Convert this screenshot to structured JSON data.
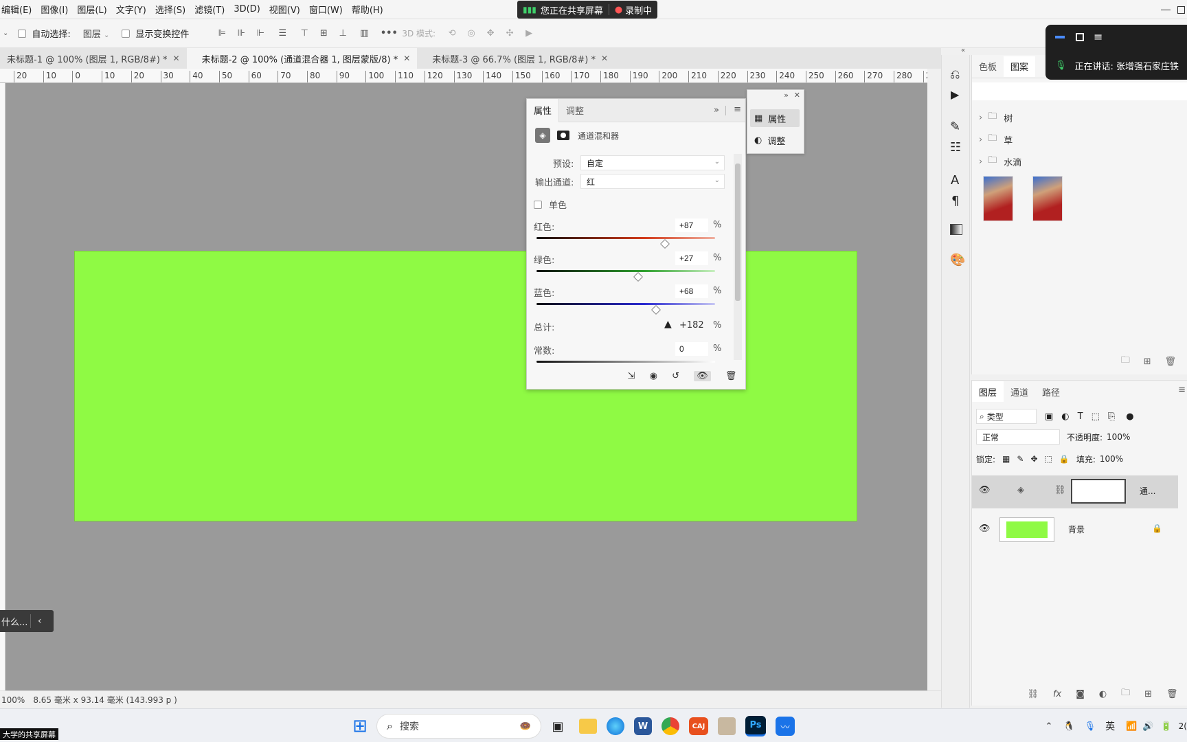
{
  "menubar": {
    "items": [
      "编辑(E)",
      "图像(I)",
      "图层(L)",
      "文字(Y)",
      "选择(S)",
      "滤镜(T)",
      "3D(D)",
      "视图(V)",
      "窗口(W)",
      "帮助(H)"
    ],
    "share_status": "您正在共享屏幕",
    "recording": "录制中"
  },
  "options": {
    "auto_select_label": "自动选择:",
    "auto_select_value": "图层",
    "show_transform_label": "显示变换控件",
    "mode_3d_label": "3D 模式:"
  },
  "tabs": [
    {
      "label": "未标题-1 @ 100% (图层 1, RGB/8#) *",
      "active": false
    },
    {
      "label": "未标题-2 @ 100% (通道混合器 1, 图层蒙版/8) *",
      "active": true
    },
    {
      "label": "未标题-3 @ 66.7% (图层 1, RGB/8#) *",
      "active": false
    }
  ],
  "ruler": {
    "ticks": [
      "20",
      "10",
      "0",
      "10",
      "20",
      "30",
      "40",
      "50",
      "60",
      "70",
      "80",
      "90",
      "100",
      "110",
      "120",
      "130",
      "140",
      "150",
      "160",
      "170",
      "180",
      "190",
      "200",
      "210",
      "220",
      "230",
      "240",
      "250",
      "260",
      "270",
      "280",
      "2"
    ]
  },
  "canvas": {
    "fill_color": "#8ffa44",
    "mini_label": "什么..."
  },
  "status": {
    "zoom": "100%",
    "info": "8.65 毫米 x 93.14 毫米 (143.993 p )"
  },
  "properties": {
    "tab_props": "属性",
    "tab_adjust": "调整",
    "adjustment_name": "通道混和器",
    "preset_label": "预设:",
    "preset_value": "自定",
    "output_label": "输出通道:",
    "output_value": "红",
    "mono_label": "单色",
    "red_label": "红色:",
    "red_value": "+87",
    "red_pct": 0.87,
    "green_label": "绿色:",
    "green_value": "+27",
    "green_pct": 0.27,
    "blue_label": "蓝色:",
    "blue_value": "+68",
    "blue_pct": 0.68,
    "total_label": "总计:",
    "total_value": "+182",
    "constant_label": "常数:",
    "constant_value": "0",
    "percent": "%"
  },
  "flyout": {
    "props": "属性",
    "adjust": "调整"
  },
  "swatches": {
    "tab_swatches": "色板",
    "tab_patterns": "图案",
    "folders": [
      "树",
      "草",
      "水滴"
    ]
  },
  "meeting": {
    "speaking": "正在讲话: 张增强石家庄铁"
  },
  "layers": {
    "tab_layers": "图层",
    "tab_channels": "通道",
    "tab_paths": "路径",
    "filter_kind": "类型",
    "blend_mode": "正常",
    "opacity_label": "不透明度:",
    "opacity_value": "100%",
    "lock_label": "锁定:",
    "fill_label": "填充:",
    "fill_value": "100%",
    "items": [
      {
        "name": "通...",
        "type": "adjustment"
      },
      {
        "name": "背景",
        "type": "background"
      }
    ]
  },
  "taskbar": {
    "search_placeholder": "搜索",
    "ime": "英",
    "time_fragment": "2(",
    "watermark": "大学的共享屏幕"
  }
}
